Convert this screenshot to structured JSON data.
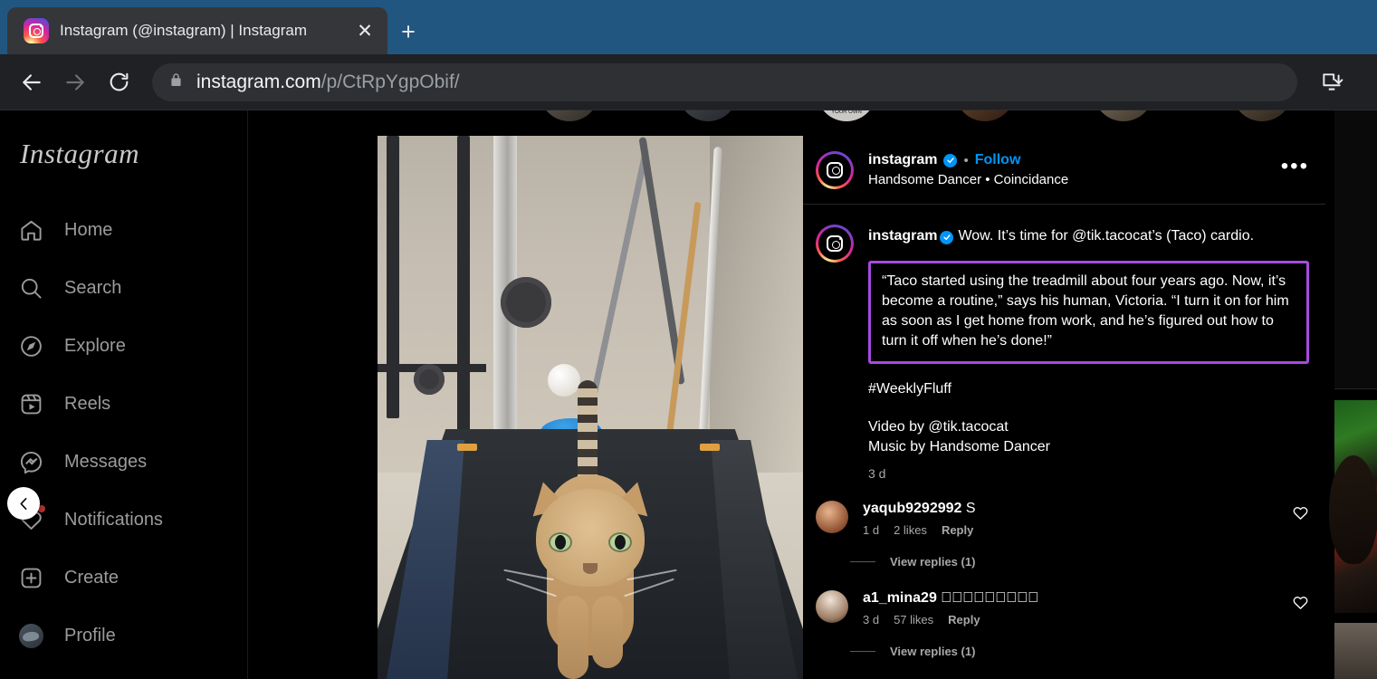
{
  "browser": {
    "tab": {
      "title": "Instagram (@instagram) | Instagram",
      "favicon": "instagram-icon",
      "close_label": "✕"
    },
    "new_tab_label": "+",
    "back_icon": "arrow-left-icon",
    "forward_icon": "arrow-right-icon",
    "reload_icon": "reload-icon",
    "lock_icon": "lock-icon",
    "download_icon": "download-icon",
    "url_host": "instagram.com",
    "url_path": "/p/CtRpYgpObif/"
  },
  "sidebar": {
    "wordmark": "Instagram",
    "collapse_icon": "chevron-left-icon",
    "items": [
      {
        "label": "Home",
        "icon": "home-icon"
      },
      {
        "label": "Search",
        "icon": "search-icon"
      },
      {
        "label": "Explore",
        "icon": "compass-icon"
      },
      {
        "label": "Reels",
        "icon": "reels-icon"
      },
      {
        "label": "Messages",
        "icon": "messenger-icon"
      },
      {
        "label": "Notifications",
        "icon": "heart-icon"
      },
      {
        "label": "Create",
        "icon": "plus-square-icon"
      },
      {
        "label": "Profile",
        "icon": "avatar-icon"
      }
    ]
  },
  "post": {
    "header": {
      "username": "instagram",
      "verified_icon": "verified-badge-icon",
      "separator": "•",
      "follow_label": "Follow",
      "audio": "Handsome Dancer • Coincidance",
      "menu_icon": "more-options-icon"
    },
    "caption": {
      "username": "instagram",
      "text": "Wow. It’s time for @tik.tacocat’s (Taco) cardio.",
      "highlight": "“Taco started using the treadmill about four years ago. Now, it’s become a routine,” says his human, Victoria. “I turn it on for him as soon as I get home from work, and he’s figured out how to turn it off when he’s done!”",
      "highlight_color": "#a64ae0",
      "hashtag": "#WeeklyFluff",
      "credit_video": "Video by @tik.tacocat",
      "credit_music": "Music by Handsome Dancer",
      "timestamp": "3 d"
    },
    "comments": [
      {
        "username": "yaqub9292992",
        "text": "S",
        "time": "1 d",
        "likes": "2 likes",
        "reply": "Reply",
        "view_replies": "View replies (1)",
        "like_icon": "heart-icon"
      },
      {
        "username": "a1_mina29",
        "text": "􀀀􀀀􀀀􀀀􀀀􀀀􀀀􀀀􀀀",
        "time": "3 d",
        "likes": "57 likes",
        "reply": "Reply",
        "view_replies": "View replies (1)",
        "like_icon": "heart-icon"
      }
    ]
  },
  "colors": {
    "tabstrip": "#215681",
    "toolbar": "#202124",
    "page_bg": "#000000",
    "link_blue": "#0095f6",
    "muted_text": "#a8a8a8",
    "highlight_purple": "#a64ae0"
  }
}
